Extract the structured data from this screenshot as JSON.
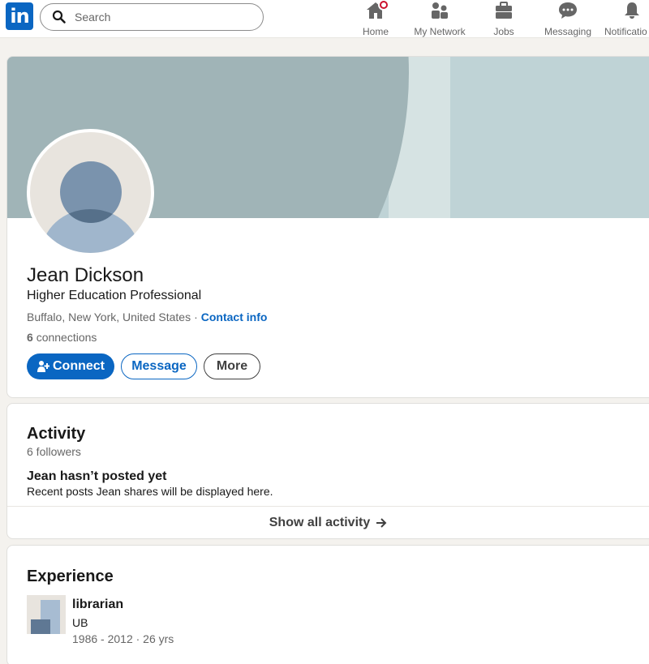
{
  "nav": {
    "logo_text": "in",
    "search_placeholder": "Search",
    "items": [
      {
        "label": "Home",
        "icon": "home-icon",
        "badge": true
      },
      {
        "label": "My Network",
        "icon": "network-icon"
      },
      {
        "label": "Jobs",
        "icon": "briefcase-icon"
      },
      {
        "label": "Messaging",
        "icon": "messaging-icon"
      },
      {
        "label": "Notificatio",
        "icon": "bell-icon"
      }
    ]
  },
  "profile": {
    "name": "Jean Dickson",
    "headline": "Higher Education Professional",
    "location": "Buffalo, New York, United States",
    "separator": "·",
    "contact_info": "Contact info",
    "connections_count": "6",
    "connections_label": "connections",
    "buttons": {
      "connect": "Connect",
      "message": "Message",
      "more": "More"
    }
  },
  "activity": {
    "title": "Activity",
    "followers": "6 followers",
    "empty_title": "Jean hasn’t posted yet",
    "empty_sub": "Recent posts Jean shares will be displayed here.",
    "show_all": "Show all activity"
  },
  "experience": {
    "title": "Experience",
    "items": [
      {
        "role": "librarian",
        "company": "UB",
        "dates": "1986 - 2012 · 26 yrs"
      }
    ]
  },
  "colors": {
    "brand": "#0a66c2",
    "badge": "#cb112d",
    "page_bg": "#f4f2ee"
  }
}
